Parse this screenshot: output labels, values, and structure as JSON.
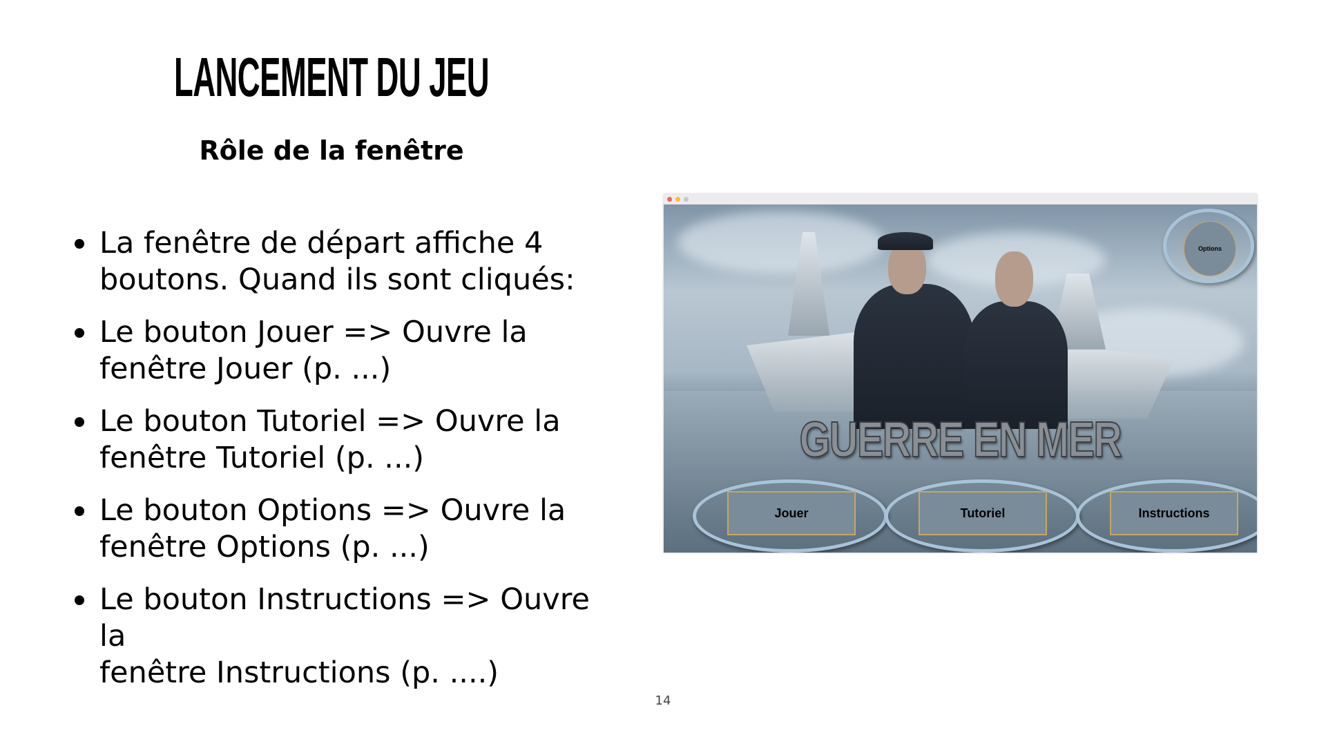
{
  "slide": {
    "title": "LANCEMENT DU JEU",
    "subtitle": "Rôle de la fenêtre",
    "bullets": [
      {
        "line1": "La fenêtre de départ affiche 4",
        "line2": "boutons. Quand ils sont cliqués:"
      },
      {
        "line1": "Le bouton Jouer => Ouvre la",
        "line2": "fenêtre Jouer (p. ...)"
      },
      {
        "line1": "Le bouton Tutoriel => Ouvre la",
        "line2": "fenêtre Tutoriel (p. ...)"
      },
      {
        "line1": "Le bouton Options => Ouvre la",
        "line2": "fenêtre Options  (p. ...)"
      },
      {
        "line1": "Le bouton Instructions => Ouvre la",
        "line2": "fenêtre Instructions (p. ....)"
      }
    ],
    "page_number": "14"
  },
  "game_window": {
    "traffic_lights": [
      "#fe5f57",
      "#febc2e",
      "#c8c8c8"
    ],
    "game_title": "GUERRE EN MER",
    "buttons": {
      "play": "Jouer",
      "tutorial": "Tutoriel",
      "instructions": "Instructions",
      "options": "Options"
    },
    "colors": {
      "button_fill": "#7a8b9a",
      "button_border": "#c9a660",
      "ring": "#a9c3d8"
    }
  }
}
